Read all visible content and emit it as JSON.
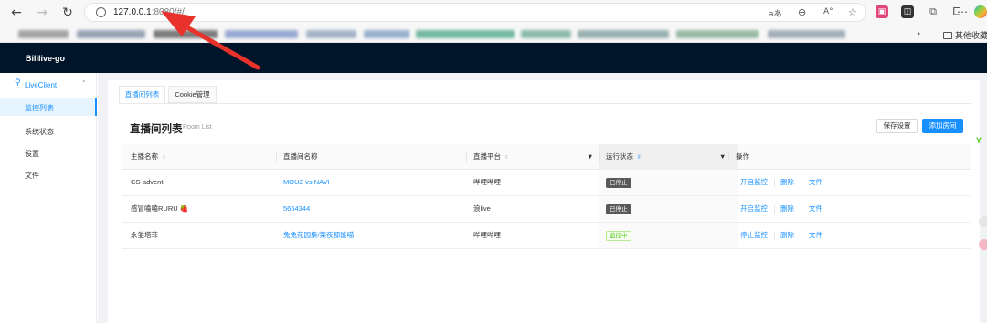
{
  "browser": {
    "address_url": "127.0.0.1",
    "address_port": ":8080/#/",
    "reader_icon_text": "aあ",
    "bookmarks_folder": "其他收藏夹",
    "nav_icons": [
      "back-arrow-icon",
      "forward-arrow-icon",
      "reload-icon"
    ],
    "accent_colors": {
      "app_header": "#001529",
      "primary": "#1890ff",
      "annotation_arrow": "#e8322b"
    }
  },
  "app": {
    "title": "Bililive-go"
  },
  "sidebar": {
    "group_label": "LiveClient",
    "items": [
      {
        "label": "监控列表",
        "active": true
      },
      {
        "label": "系统状态",
        "active": false
      },
      {
        "label": "设置",
        "active": false
      },
      {
        "label": "文件",
        "active": false
      }
    ]
  },
  "tabs": [
    {
      "label": "直播间列表",
      "active": true
    },
    {
      "label": "Cookie管理",
      "active": false
    }
  ],
  "page": {
    "title": "直播间列表",
    "subtitle": "Room List",
    "save_button": "保存设置",
    "add_button": "添加房间"
  },
  "table": {
    "columns": [
      "主播名称",
      "直播间名称",
      "直播平台",
      "运行状态",
      "操作"
    ],
    "rows": [
      {
        "streamer": "CS-advent",
        "room": "MOUZ vs NAVI",
        "platform": "哔哩哔哩",
        "status": "已停止",
        "status_type": "stopped",
        "actions": [
          "开启监控",
          "删除",
          "文件"
        ]
      },
      {
        "streamer": "感冒嗑嗑RURU 🍓",
        "room": "5664344",
        "platform": "浪live",
        "status": "已停止",
        "status_type": "stopped",
        "actions": [
          "开启监控",
          "删除",
          "文件"
        ]
      },
      {
        "streamer": "永雏塔菲",
        "room": "兔兔花园集/菜夜都能喵",
        "platform": "哔哩哔哩",
        "status": "监控中",
        "status_type": "monitor",
        "actions": [
          "停止监控",
          "删除",
          "文件"
        ]
      }
    ]
  }
}
